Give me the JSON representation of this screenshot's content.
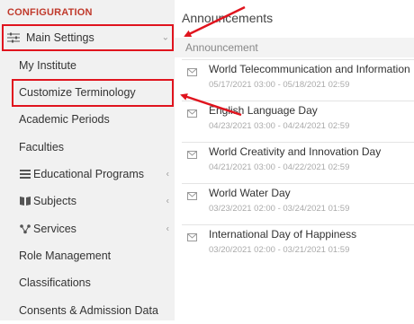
{
  "sidebar": {
    "header": "CONFIGURATION",
    "main_settings": {
      "label": "Main Settings",
      "icon": "sliders-icon"
    },
    "items": [
      {
        "label": "My Institute"
      },
      {
        "label": "Customize Terminology"
      },
      {
        "label": "Academic Periods"
      },
      {
        "label": "Faculties"
      },
      {
        "label": "Educational Programs",
        "icon": "list-icon"
      },
      {
        "label": "Subjects",
        "icon": "book-icon"
      },
      {
        "label": "Services",
        "icon": "network-icon"
      },
      {
        "label": "Role Management"
      },
      {
        "label": "Classifications"
      },
      {
        "label": "Consents & Admission Data"
      }
    ]
  },
  "announcements": {
    "title": "Announcements",
    "column_header": "Announcement",
    "items": [
      {
        "title": "World Telecommunication and Information",
        "dates": "05/17/2021 03:00 - 05/18/2021 02:59"
      },
      {
        "title": "English Language Day",
        "dates": "04/23/2021 03:00 - 04/24/2021 02:59"
      },
      {
        "title": "World Creativity and Innovation Day",
        "dates": "04/21/2021 03:00 - 04/22/2021 02:59"
      },
      {
        "title": "World Water Day",
        "dates": "03/23/2021 02:00 - 03/24/2021 01:59"
      },
      {
        "title": "International Day of Happiness",
        "dates": "03/20/2021 02:00 - 03/21/2021 01:59"
      }
    ]
  },
  "colors": {
    "accent_red": "#e0141e",
    "header_red": "#c0392b",
    "sidebar_bg": "#f1f1f1"
  }
}
